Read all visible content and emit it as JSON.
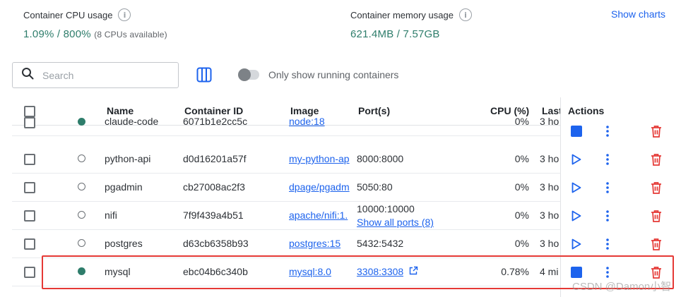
{
  "stats": {
    "cpu": {
      "title": "Container CPU usage",
      "value": "1.09% / 800%",
      "sub": "(8 CPUs available)"
    },
    "memory": {
      "title": "Container memory usage",
      "value": "621.4MB / 7.57GB"
    },
    "show_charts": "Show charts"
  },
  "toolbar": {
    "search_placeholder": "Search",
    "running_only_label": "Only show running containers",
    "running_only_on": false
  },
  "table": {
    "headers": {
      "name": "Name",
      "container_id": "Container ID",
      "image": "Image",
      "ports": "Port(s)",
      "cpu": "CPU (%)",
      "last": "Last",
      "actions": "Actions"
    },
    "rows": [
      {
        "status": "running",
        "name": "claude-code",
        "id": "6071b1e2cc5c",
        "image": "node:18",
        "port": "",
        "port2": "",
        "cpu": "0%",
        "last": "3 ho"
      },
      {
        "status": "stopped",
        "name": "python-api",
        "id": "d0d16201a57f",
        "image": "my-python-ap",
        "port": "8000:8000",
        "port2": "",
        "cpu": "0%",
        "last": "3 ho"
      },
      {
        "status": "stopped",
        "name": "pgadmin",
        "id": "cb27008ac2f3",
        "image": "dpage/pgadm",
        "port": "5050:80",
        "port2": "",
        "cpu": "0%",
        "last": "3 ho"
      },
      {
        "status": "stopped",
        "name": "nifi",
        "id": "7f9f439a4b51",
        "image": "apache/nifi:1.",
        "port": "10000:10000",
        "port2": "Show all ports (8)",
        "cpu": "0%",
        "last": "3 ho"
      },
      {
        "status": "stopped",
        "name": "postgres",
        "id": "d63cb6358b93",
        "image": "postgres:15",
        "port": "5432:5432",
        "port2": "",
        "cpu": "0%",
        "last": "3 ho"
      },
      {
        "status": "running",
        "name": "mysql",
        "id": "ebc04b6c340b",
        "image": "mysql:8.0",
        "port": "3308:3308",
        "port2": "",
        "cpu": "0.78%",
        "last": "4 mi"
      }
    ]
  },
  "colors": {
    "accent": "#1d63ed",
    "running": "#2e7d6b",
    "delete": "#e53935",
    "highlight": "#e53935"
  },
  "watermark": "CSDN @Damon小智"
}
